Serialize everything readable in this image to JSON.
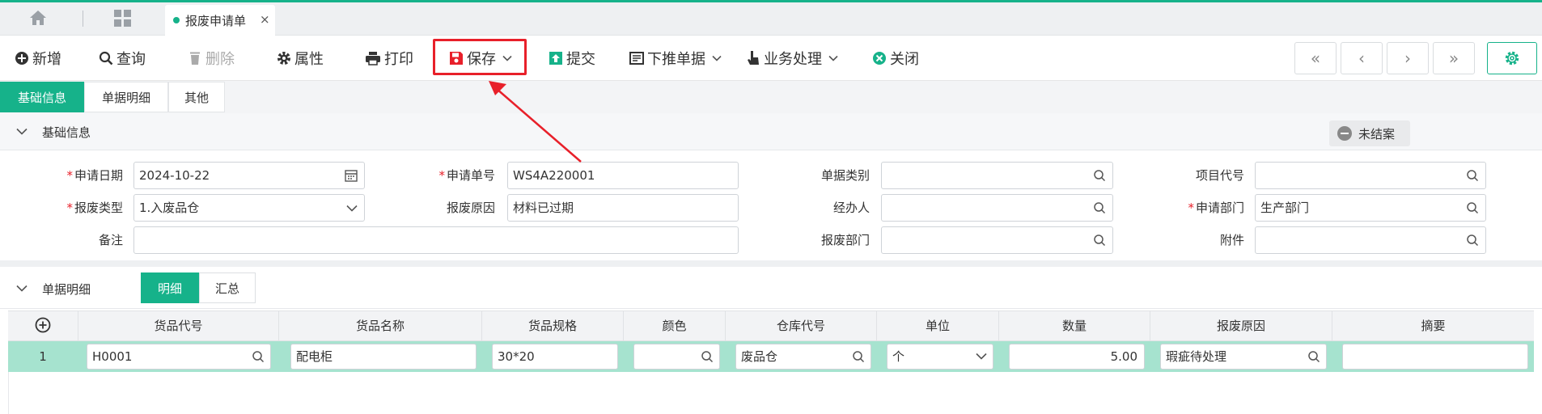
{
  "tabbar": {
    "doc_tab_label": "报废申请单",
    "doc_tab_close": "×"
  },
  "toolbar": {
    "add": "新增",
    "query": "查询",
    "delete": "删除",
    "properties": "属性",
    "print": "打印",
    "save": "保存",
    "submit": "提交",
    "push_down": "下推单据",
    "business": "业务处理",
    "close": "关闭",
    "nav": {
      "first": "«",
      "prev": "‹",
      "next": "›",
      "last": "»"
    }
  },
  "section_tabs": [
    "基础信息",
    "单据明细",
    "其他"
  ],
  "basic": {
    "title": "基础信息",
    "status": "未结案",
    "labels": {
      "apply_date": "申请日期",
      "apply_no": "申请单号",
      "doc_category": "单据类别",
      "project_code": "项目代号",
      "scrap_type": "报废类型",
      "scrap_reason": "报废原因",
      "handler": "经办人",
      "apply_dept": "申请部门",
      "remark": "备注",
      "scrap_dept": "报废部门",
      "attachment": "附件"
    },
    "values": {
      "apply_date": "2024-10-22",
      "apply_no": "WS4A220001",
      "doc_category": "",
      "project_code": "",
      "scrap_type": "1.入废品仓",
      "scrap_reason": "材料已过期",
      "handler": "",
      "apply_dept": "生产部门",
      "remark": "",
      "scrap_dept": "",
      "attachment": ""
    }
  },
  "detail": {
    "title": "单据明细",
    "views": [
      "明细",
      "汇总"
    ],
    "columns": [
      "货品代号",
      "货品名称",
      "货品规格",
      "颜色",
      "仓库代号",
      "单位",
      "数量",
      "报废原因",
      "摘要"
    ],
    "rows": [
      {
        "no": "1",
        "code": "H0001",
        "name": "配电柜",
        "spec": "30*20",
        "color": "",
        "warehouse": "废品仓",
        "unit": "个",
        "qty": "5.00",
        "reason": "瑕疵待处理",
        "summary": ""
      }
    ]
  },
  "colors": {
    "accent": "#16b28a",
    "highlight": "#e8202a",
    "row_selected": "#a6e3cf"
  }
}
